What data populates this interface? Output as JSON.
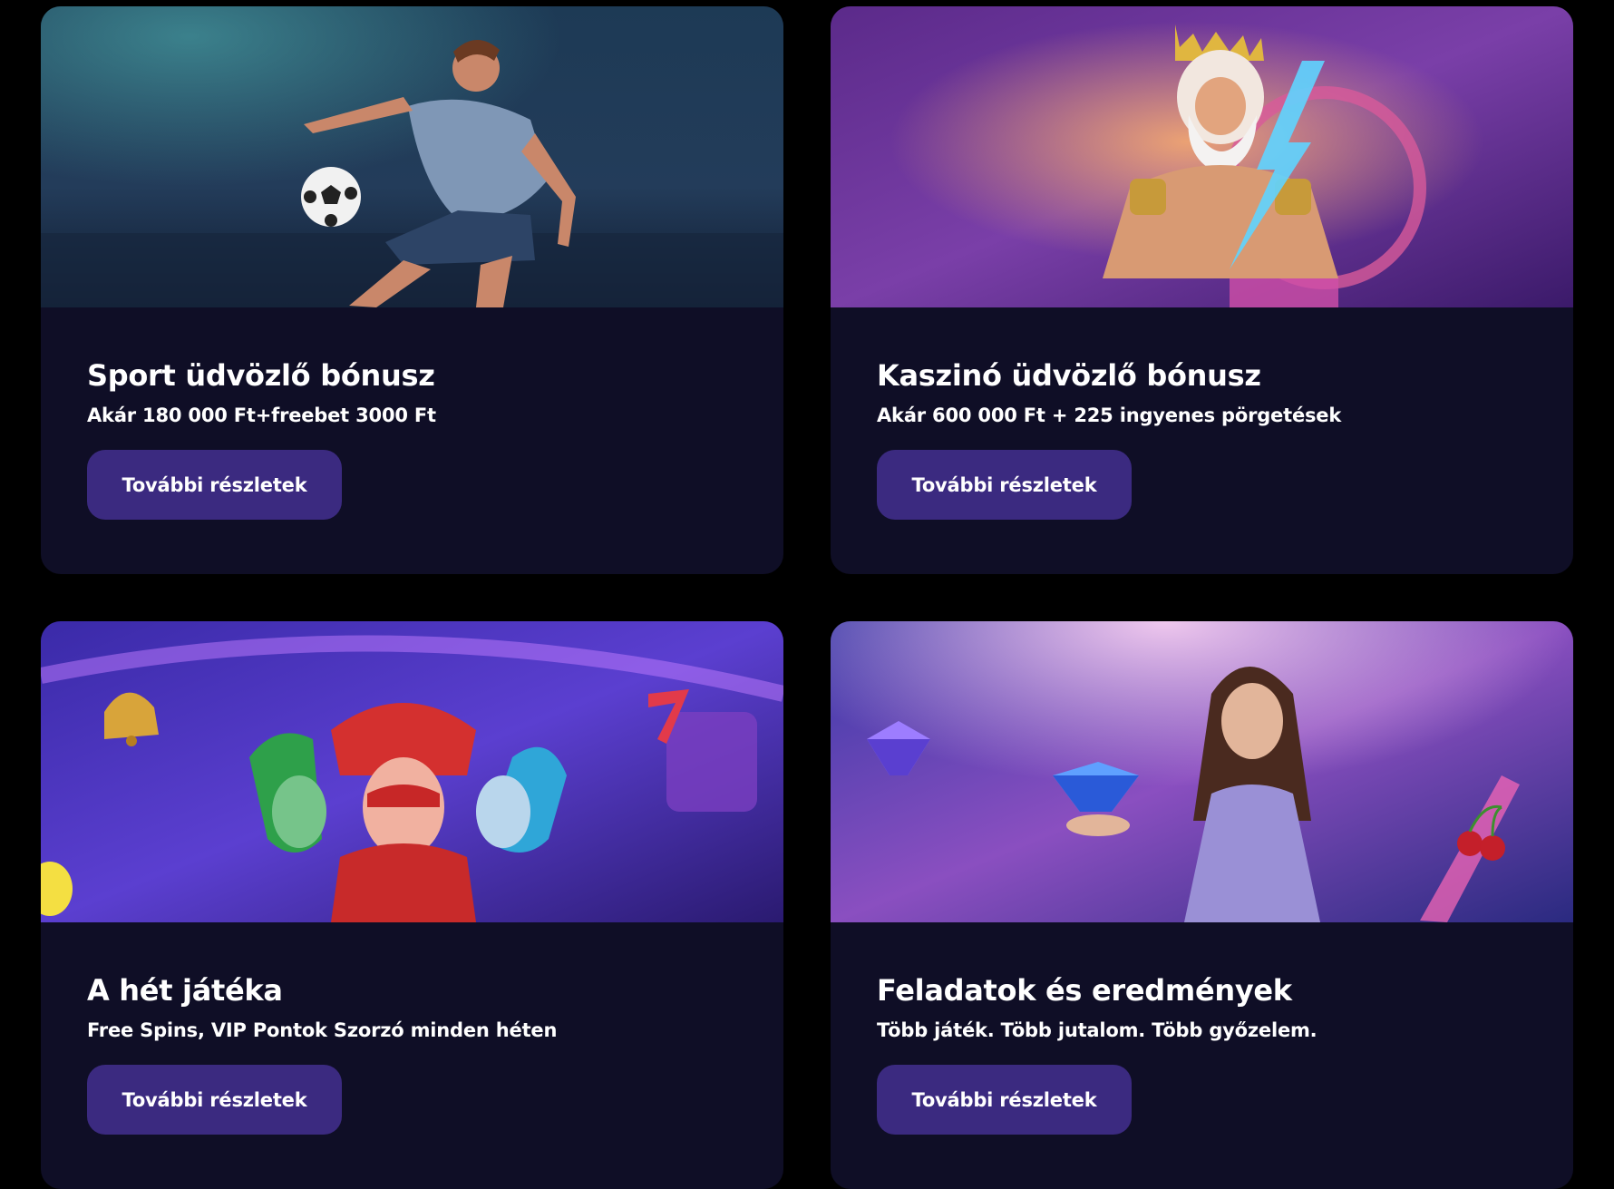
{
  "cards": [
    {
      "title": "Sport üdvözlő bónusz",
      "subtitle": "Akár 180 000 Ft+freebet 3000 Ft",
      "button_label": "További részletek",
      "image": "football-player-kicking-ball"
    },
    {
      "title": "Kaszinó üdvözlő bónusz",
      "subtitle": "Akár 600 000 Ft + 225 ingyenes pörgetések",
      "button_label": "További részletek",
      "image": "zeus-with-lightning"
    },
    {
      "title": "A hét játéka",
      "subtitle": "Free Spins, VIP Pontok Szorzó minden héten",
      "button_label": "További részletek",
      "image": "three-jesters-slot-art"
    },
    {
      "title": "Feladatok és eredmények",
      "subtitle": "Több játék. Több jutalom. Több győzelem.",
      "button_label": "További részletek",
      "image": "woman-holding-diamond"
    }
  ],
  "colors": {
    "page_bg": "#000000",
    "card_bg": "#0f0e26",
    "button_bg": "#3b2a80",
    "text": "#ffffff"
  }
}
